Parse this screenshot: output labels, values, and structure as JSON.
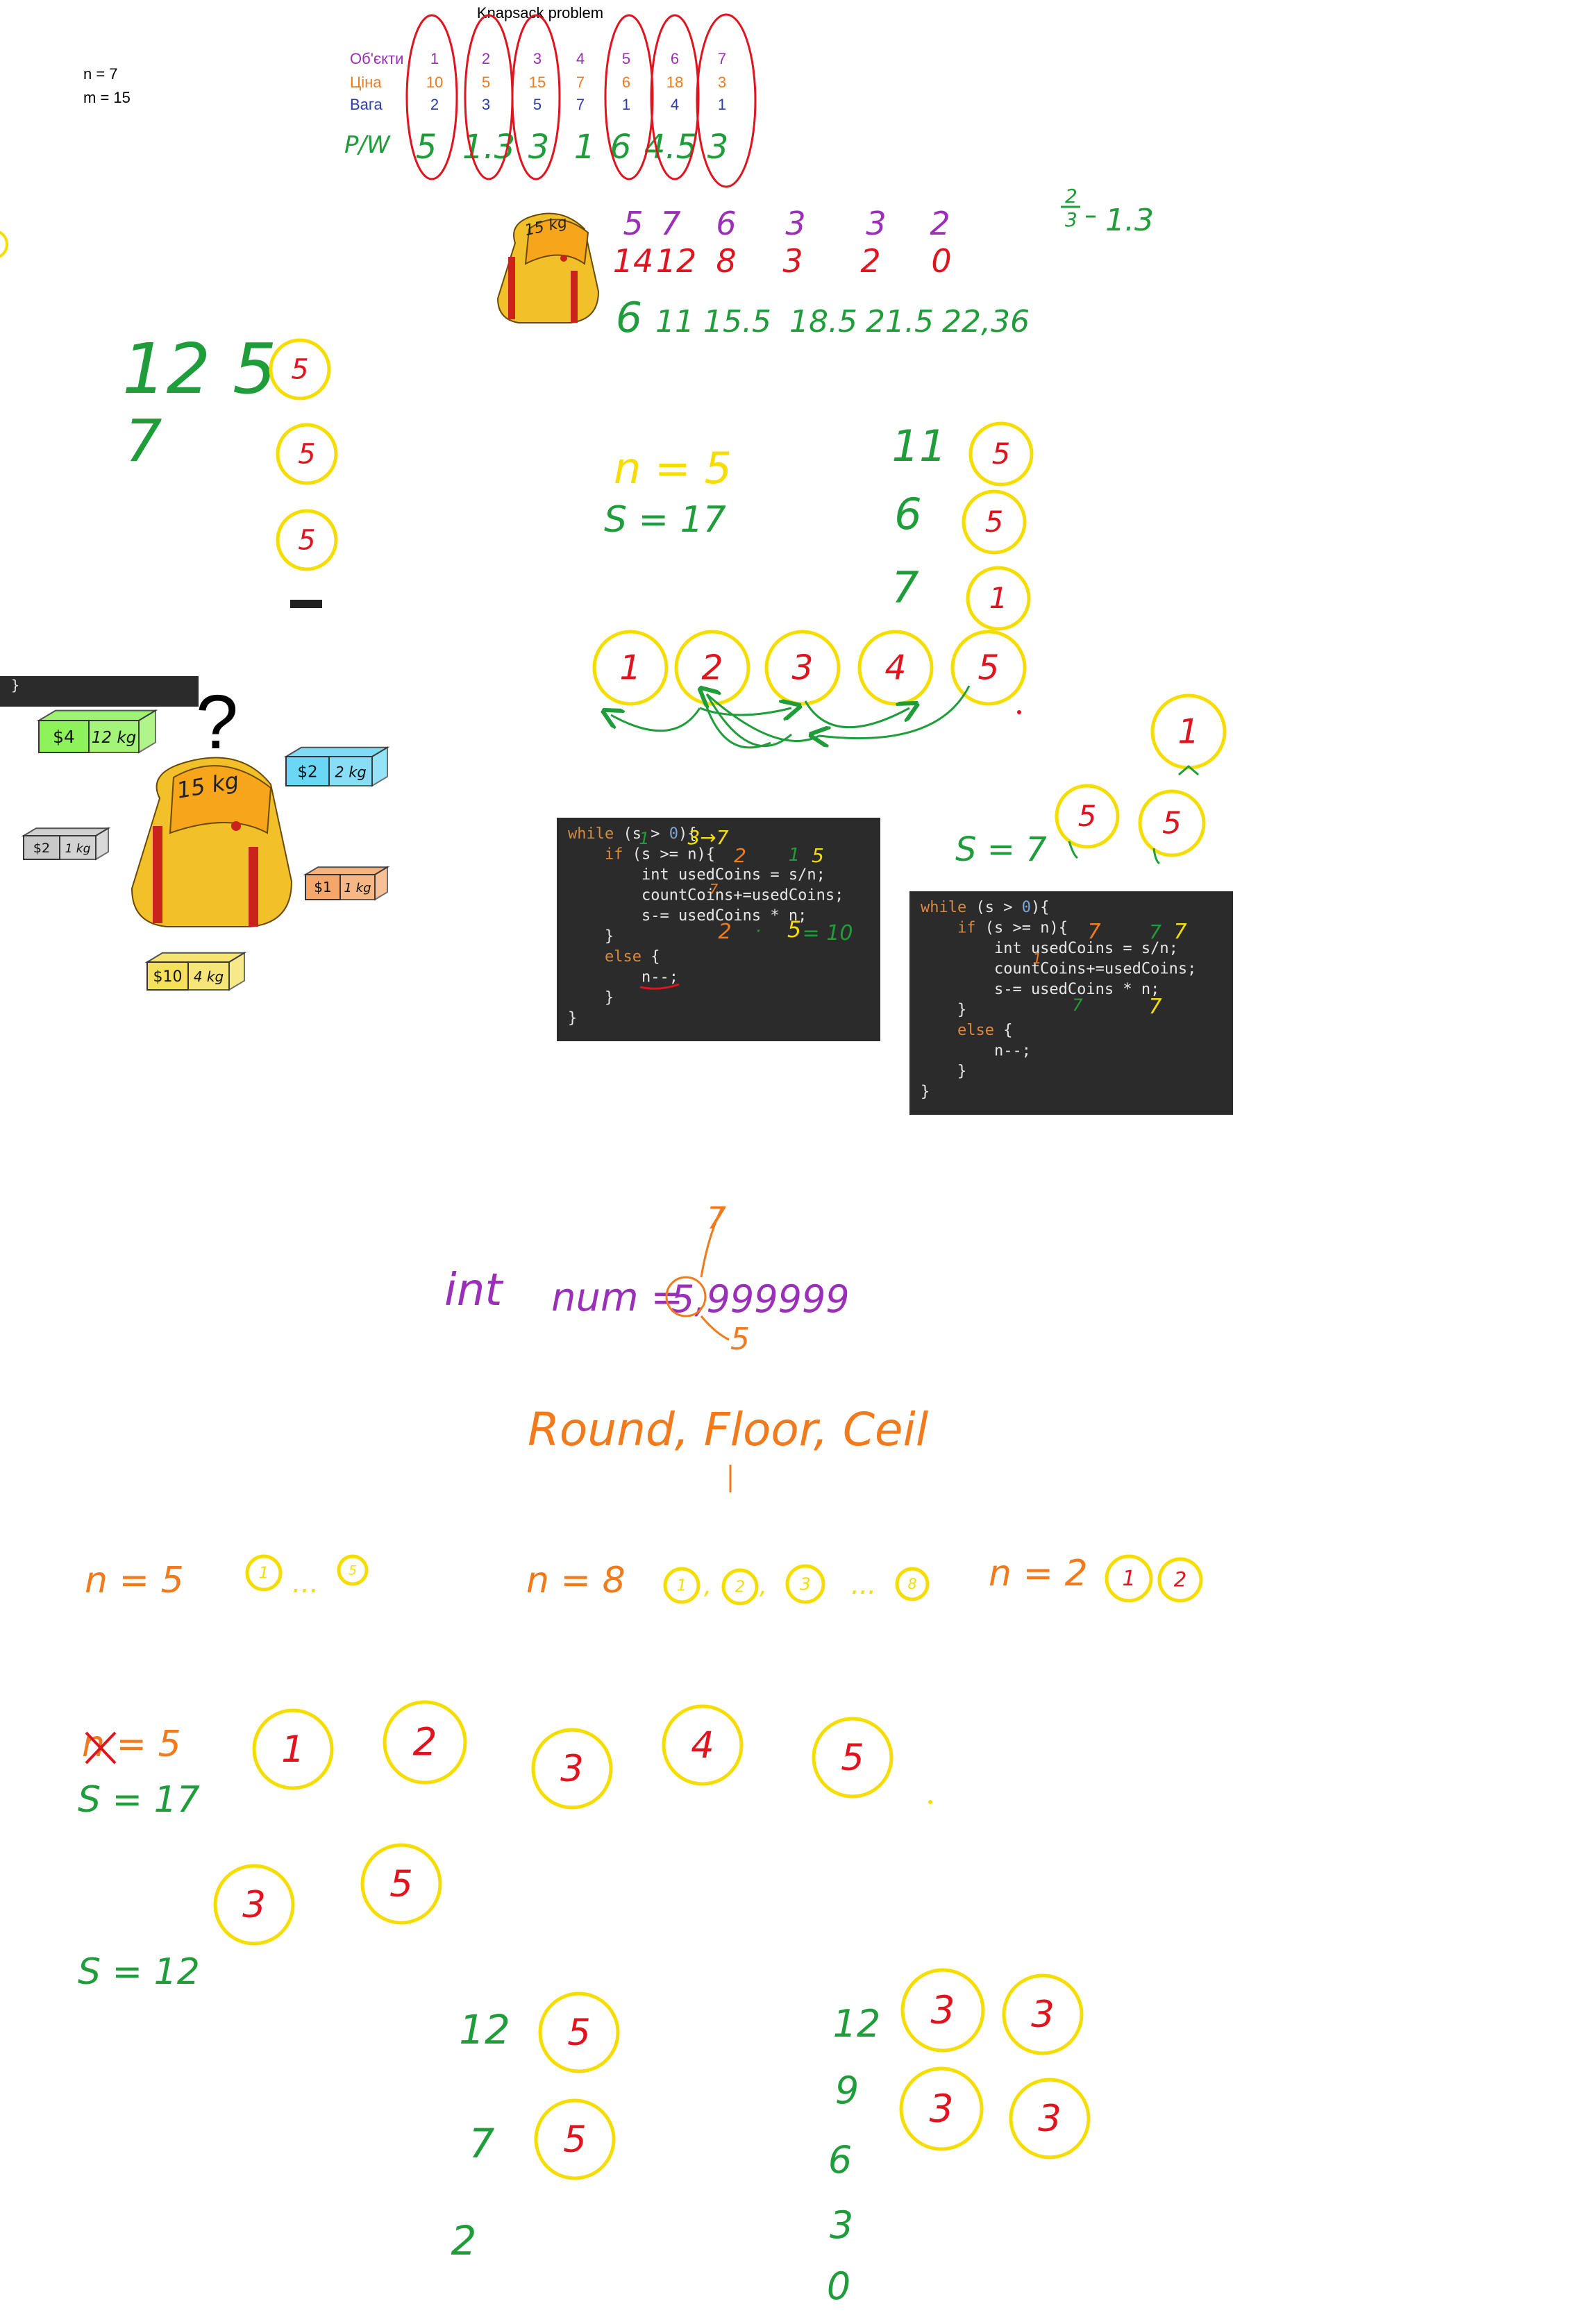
{
  "title": "Knapsack problem",
  "params": {
    "n": "n = 7",
    "m": "m = 15"
  },
  "table": {
    "labels": {
      "objects": "Об'єкти",
      "price": "Ціна",
      "weight": "Вага"
    },
    "objects": [
      "1",
      "2",
      "3",
      "4",
      "5",
      "6",
      "7"
    ],
    "prices": [
      "10",
      "5",
      "15",
      "7",
      "6",
      "18",
      "3"
    ],
    "weights": [
      "2",
      "3",
      "5",
      "7",
      "1",
      "4",
      "1"
    ],
    "ratio_label": "P/W",
    "ratios": [
      "5",
      "1.3",
      "3",
      "1",
      "6",
      "4.5",
      "3"
    ]
  },
  "ink": {
    "green": "#1f9d3a",
    "red": "#e0141e",
    "yellow": "#f5dd00",
    "orange": "#f07a1c",
    "purple": "#9a2fb8",
    "blue": "#2b3bb0"
  },
  "bag": {
    "label_small": "15 kg",
    "label_big": "15 kg"
  },
  "items": [
    {
      "price": "$4",
      "weight": "12 kg",
      "color": "#8ef25a"
    },
    {
      "price": "$2",
      "weight": "2 kg",
      "color": "#6ad7f5"
    },
    {
      "price": "$2",
      "weight": "1 kg",
      "color": "#c9c9c9"
    },
    {
      "price": "$1",
      "weight": "1 kg",
      "color": "#f5a66a"
    },
    {
      "price": "$10",
      "weight": "4 kg",
      "color": "#f5e05a"
    }
  ],
  "question_mark": "?",
  "brace_snippet": "}",
  "rows": {
    "purple": [
      "5",
      "7",
      "6",
      "3",
      "3",
      "2"
    ],
    "red": [
      "14",
      "12",
      "8",
      "3",
      "2",
      "0"
    ],
    "green": [
      "6",
      "11",
      "15.5",
      "18.5",
      "21.5",
      "22,36"
    ],
    "fraction_num": "2",
    "fraction_den": "3",
    "fraction_result": "1.3"
  },
  "left_notes": {
    "big": "12 5",
    "small": "7",
    "coin": "5",
    "dash": "–"
  },
  "middle": {
    "n": "n = 5",
    "s": "S = 17",
    "col_nums": [
      "11",
      "6",
      "7"
    ],
    "col_coins": [
      "5",
      "5",
      "1"
    ],
    "row_coins": [
      "1",
      "2",
      "3",
      "4",
      "5"
    ]
  },
  "right_mid": {
    "s": "S = 7",
    "coins": [
      "5",
      "5"
    ],
    "top_coin": "1"
  },
  "code1": {
    "lines": [
      "while (s > 0){",
      "    if (s >= n){",
      "        int usedCoins = s/n;",
      "        countCoins+=usedCoins;",
      "        s-= usedCoins * n;",
      "    }",
      "    else {",
      "        n--;",
      "    }",
      "}"
    ],
    "anno": [
      "1",
      "3→7",
      "2",
      "1",
      "5",
      "2",
      "·",
      "5",
      "= 10",
      "7"
    ]
  },
  "code2": {
    "lines": [
      "while (s > 0){",
      "    if (s >= n){",
      "        int usedCoins = s/n;",
      "        countCoins+=usedCoins;",
      "        s-= usedCoins * n;",
      "    }",
      "    else {",
      "        n--;",
      "    }",
      "}"
    ],
    "anno": [
      "7",
      "7",
      "7",
      "1",
      "7",
      "7"
    ]
  },
  "num_line": {
    "int": "int",
    "num": "num =",
    "value": "5,999999",
    "arrow_up": "7",
    "arrow_down": "5",
    "funcs": "Round, Floor, Ceil"
  },
  "examples": [
    {
      "n": "n = 5",
      "coins": "1 ... 5"
    },
    {
      "n": "n = 8",
      "coins": "1, 2, 3 ... 8"
    },
    {
      "n": "n = 2",
      "coins": "1 2"
    }
  ],
  "bottom": {
    "n_crossed": "n = 5",
    "s17": "S = 17",
    "row_coins": [
      "1",
      "2",
      "3",
      "4",
      "5"
    ],
    "pair_coins": [
      "3",
      "5"
    ],
    "s12": "S = 12",
    "col1_nums": [
      "12",
      "7",
      "2"
    ],
    "col1_coins": [
      "5",
      "5"
    ],
    "col2_nums": [
      "12",
      "9",
      "6",
      "3",
      "0"
    ],
    "col2_coins": [
      "3",
      "3",
      "3",
      "3"
    ]
  }
}
